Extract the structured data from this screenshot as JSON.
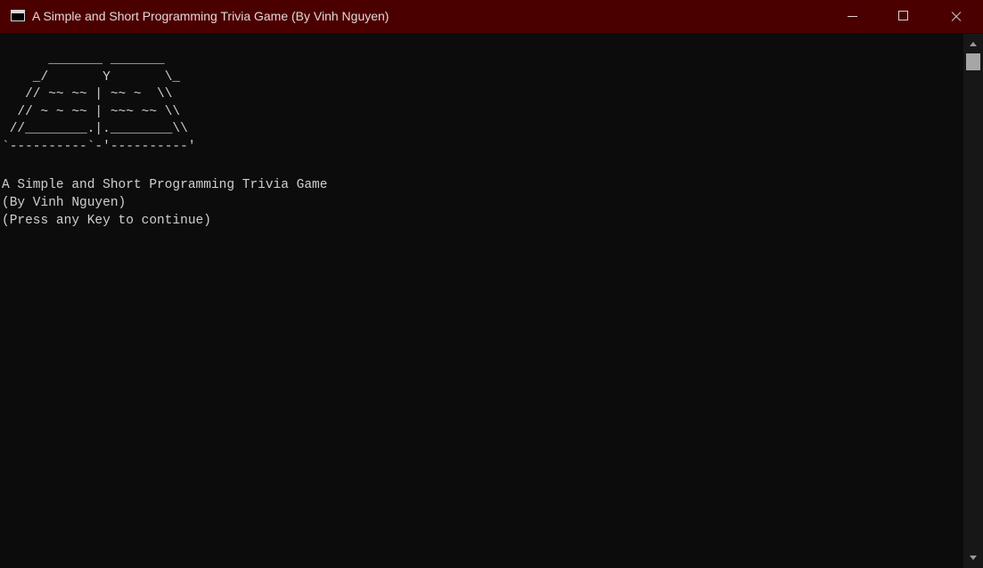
{
  "window": {
    "title": "A Simple and Short Programming Trivia Game (By Vinh Nguyen)"
  },
  "console": {
    "ascii_art": "      _______ _______\n    _/       Y       \\_\n   // ~~ ~~ | ~~ ~  \\\\\n  // ~ ~ ~~ | ~~~ ~~ \\\\\n //________.|.________\\\\\n`----------`-'----------'",
    "lines": [
      "A Simple and Short Programming Trivia Game",
      "(By Vinh Nguyen)",
      "(Press any Key to continue)"
    ]
  },
  "colors": {
    "titlebar": "#4b0000",
    "background": "#0c0c0c",
    "text": "#d0d0d0"
  },
  "icons": {
    "app": "console-icon",
    "minimize": "minimize-icon",
    "maximize": "maximize-icon",
    "close": "close-icon"
  }
}
